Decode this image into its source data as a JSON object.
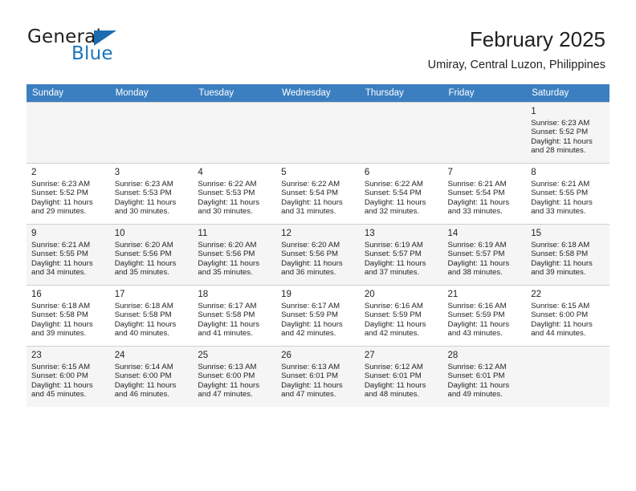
{
  "brand": {
    "name_part1": "General",
    "name_part2": "Blue",
    "logo_icon": "triangle-flag-icon",
    "accent_color": "#1b75bc",
    "header_color": "#3c7fc1"
  },
  "header": {
    "title": "February 2025",
    "location": "Umiray, Central Luzon, Philippines"
  },
  "weekday_headers": [
    "Sunday",
    "Monday",
    "Tuesday",
    "Wednesday",
    "Thursday",
    "Friday",
    "Saturday"
  ],
  "weeks": [
    [
      {
        "empty": true
      },
      {
        "empty": true
      },
      {
        "empty": true
      },
      {
        "empty": true
      },
      {
        "empty": true
      },
      {
        "empty": true
      },
      {
        "day": "1",
        "sunrise": "Sunrise: 6:23 AM",
        "sunset": "Sunset: 5:52 PM",
        "daylight1": "Daylight: 11 hours",
        "daylight2": "and 28 minutes."
      }
    ],
    [
      {
        "day": "2",
        "sunrise": "Sunrise: 6:23 AM",
        "sunset": "Sunset: 5:52 PM",
        "daylight1": "Daylight: 11 hours",
        "daylight2": "and 29 minutes."
      },
      {
        "day": "3",
        "sunrise": "Sunrise: 6:23 AM",
        "sunset": "Sunset: 5:53 PM",
        "daylight1": "Daylight: 11 hours",
        "daylight2": "and 30 minutes."
      },
      {
        "day": "4",
        "sunrise": "Sunrise: 6:22 AM",
        "sunset": "Sunset: 5:53 PM",
        "daylight1": "Daylight: 11 hours",
        "daylight2": "and 30 minutes."
      },
      {
        "day": "5",
        "sunrise": "Sunrise: 6:22 AM",
        "sunset": "Sunset: 5:54 PM",
        "daylight1": "Daylight: 11 hours",
        "daylight2": "and 31 minutes."
      },
      {
        "day": "6",
        "sunrise": "Sunrise: 6:22 AM",
        "sunset": "Sunset: 5:54 PM",
        "daylight1": "Daylight: 11 hours",
        "daylight2": "and 32 minutes."
      },
      {
        "day": "7",
        "sunrise": "Sunrise: 6:21 AM",
        "sunset": "Sunset: 5:54 PM",
        "daylight1": "Daylight: 11 hours",
        "daylight2": "and 33 minutes."
      },
      {
        "day": "8",
        "sunrise": "Sunrise: 6:21 AM",
        "sunset": "Sunset: 5:55 PM",
        "daylight1": "Daylight: 11 hours",
        "daylight2": "and 33 minutes."
      }
    ],
    [
      {
        "day": "9",
        "sunrise": "Sunrise: 6:21 AM",
        "sunset": "Sunset: 5:55 PM",
        "daylight1": "Daylight: 11 hours",
        "daylight2": "and 34 minutes."
      },
      {
        "day": "10",
        "sunrise": "Sunrise: 6:20 AM",
        "sunset": "Sunset: 5:56 PM",
        "daylight1": "Daylight: 11 hours",
        "daylight2": "and 35 minutes."
      },
      {
        "day": "11",
        "sunrise": "Sunrise: 6:20 AM",
        "sunset": "Sunset: 5:56 PM",
        "daylight1": "Daylight: 11 hours",
        "daylight2": "and 35 minutes."
      },
      {
        "day": "12",
        "sunrise": "Sunrise: 6:20 AM",
        "sunset": "Sunset: 5:56 PM",
        "daylight1": "Daylight: 11 hours",
        "daylight2": "and 36 minutes."
      },
      {
        "day": "13",
        "sunrise": "Sunrise: 6:19 AM",
        "sunset": "Sunset: 5:57 PM",
        "daylight1": "Daylight: 11 hours",
        "daylight2": "and 37 minutes."
      },
      {
        "day": "14",
        "sunrise": "Sunrise: 6:19 AM",
        "sunset": "Sunset: 5:57 PM",
        "daylight1": "Daylight: 11 hours",
        "daylight2": "and 38 minutes."
      },
      {
        "day": "15",
        "sunrise": "Sunrise: 6:18 AM",
        "sunset": "Sunset: 5:58 PM",
        "daylight1": "Daylight: 11 hours",
        "daylight2": "and 39 minutes."
      }
    ],
    [
      {
        "day": "16",
        "sunrise": "Sunrise: 6:18 AM",
        "sunset": "Sunset: 5:58 PM",
        "daylight1": "Daylight: 11 hours",
        "daylight2": "and 39 minutes."
      },
      {
        "day": "17",
        "sunrise": "Sunrise: 6:18 AM",
        "sunset": "Sunset: 5:58 PM",
        "daylight1": "Daylight: 11 hours",
        "daylight2": "and 40 minutes."
      },
      {
        "day": "18",
        "sunrise": "Sunrise: 6:17 AM",
        "sunset": "Sunset: 5:58 PM",
        "daylight1": "Daylight: 11 hours",
        "daylight2": "and 41 minutes."
      },
      {
        "day": "19",
        "sunrise": "Sunrise: 6:17 AM",
        "sunset": "Sunset: 5:59 PM",
        "daylight1": "Daylight: 11 hours",
        "daylight2": "and 42 minutes."
      },
      {
        "day": "20",
        "sunrise": "Sunrise: 6:16 AM",
        "sunset": "Sunset: 5:59 PM",
        "daylight1": "Daylight: 11 hours",
        "daylight2": "and 42 minutes."
      },
      {
        "day": "21",
        "sunrise": "Sunrise: 6:16 AM",
        "sunset": "Sunset: 5:59 PM",
        "daylight1": "Daylight: 11 hours",
        "daylight2": "and 43 minutes."
      },
      {
        "day": "22",
        "sunrise": "Sunrise: 6:15 AM",
        "sunset": "Sunset: 6:00 PM",
        "daylight1": "Daylight: 11 hours",
        "daylight2": "and 44 minutes."
      }
    ],
    [
      {
        "day": "23",
        "sunrise": "Sunrise: 6:15 AM",
        "sunset": "Sunset: 6:00 PM",
        "daylight1": "Daylight: 11 hours",
        "daylight2": "and 45 minutes."
      },
      {
        "day": "24",
        "sunrise": "Sunrise: 6:14 AM",
        "sunset": "Sunset: 6:00 PM",
        "daylight1": "Daylight: 11 hours",
        "daylight2": "and 46 minutes."
      },
      {
        "day": "25",
        "sunrise": "Sunrise: 6:13 AM",
        "sunset": "Sunset: 6:00 PM",
        "daylight1": "Daylight: 11 hours",
        "daylight2": "and 47 minutes."
      },
      {
        "day": "26",
        "sunrise": "Sunrise: 6:13 AM",
        "sunset": "Sunset: 6:01 PM",
        "daylight1": "Daylight: 11 hours",
        "daylight2": "and 47 minutes."
      },
      {
        "day": "27",
        "sunrise": "Sunrise: 6:12 AM",
        "sunset": "Sunset: 6:01 PM",
        "daylight1": "Daylight: 11 hours",
        "daylight2": "and 48 minutes."
      },
      {
        "day": "28",
        "sunrise": "Sunrise: 6:12 AM",
        "sunset": "Sunset: 6:01 PM",
        "daylight1": "Daylight: 11 hours",
        "daylight2": "and 49 minutes."
      },
      {
        "empty": true
      }
    ]
  ]
}
